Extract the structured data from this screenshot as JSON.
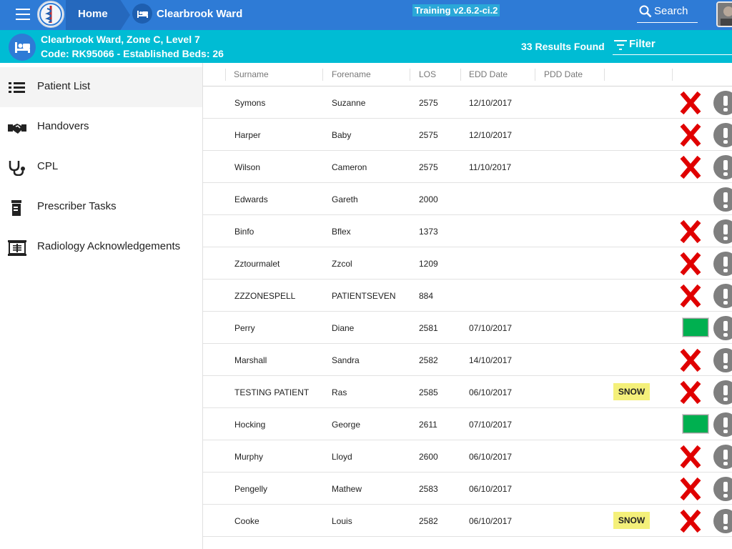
{
  "header": {
    "home_label": "Home",
    "ward_label": "Clearbrook Ward",
    "version": "Training v2.6.2-ci.2",
    "search_label": "Search"
  },
  "ward": {
    "line1": "Clearbrook Ward, Zone C, Level 7",
    "line2": "Code: RK95066 - Established Beds: 26",
    "results": "33 Results Found",
    "filter_label": "Filter"
  },
  "sidebar": {
    "items": [
      {
        "label": "Patient List",
        "icon": "list-icon"
      },
      {
        "label": "Handovers",
        "icon": "handshake-icon"
      },
      {
        "label": "CPL",
        "icon": "stethoscope-icon"
      },
      {
        "label": "Prescriber Tasks",
        "icon": "pill-bottle-icon"
      },
      {
        "label": "Radiology Acknowledgements",
        "icon": "xray-icon"
      }
    ]
  },
  "table": {
    "columns": [
      "Surname",
      "Forename",
      "LOS",
      "EDD Date",
      "PDD Date"
    ],
    "rows": [
      {
        "surname": "Symons",
        "forename": "Suzanne",
        "los": "2575",
        "edd": "12/10/2017",
        "pdd": "",
        "tag": "",
        "status": "red-x"
      },
      {
        "surname": "Harper",
        "forename": "Baby",
        "los": "2575",
        "edd": "12/10/2017",
        "pdd": "",
        "tag": "",
        "status": "red-x"
      },
      {
        "surname": "Wilson",
        "forename": "Cameron",
        "los": "2575",
        "edd": "11/10/2017",
        "pdd": "",
        "tag": "",
        "status": "red-x"
      },
      {
        "surname": "Edwards",
        "forename": "Gareth",
        "los": "2000",
        "edd": "",
        "pdd": "",
        "tag": "",
        "status": "none"
      },
      {
        "surname": "Binfo",
        "forename": "Bflex",
        "los": "1373",
        "edd": "",
        "pdd": "",
        "tag": "",
        "status": "red-x"
      },
      {
        "surname": "Zztourmalet",
        "forename": "Zzcol",
        "los": "1209",
        "edd": "",
        "pdd": "",
        "tag": "",
        "status": "red-x"
      },
      {
        "surname": "ZZZONESPELL",
        "forename": "PATIENTSEVEN",
        "los": "884",
        "edd": "",
        "pdd": "",
        "tag": "",
        "status": "red-x"
      },
      {
        "surname": "Perry",
        "forename": "Diane",
        "los": "2581",
        "edd": "07/10/2017",
        "pdd": "",
        "tag": "",
        "status": "green"
      },
      {
        "surname": "Marshall",
        "forename": "Sandra",
        "los": "2582",
        "edd": "14/10/2017",
        "pdd": "",
        "tag": "",
        "status": "red-x"
      },
      {
        "surname": "TESTING PATIENT",
        "forename": "Ras",
        "los": "2585",
        "edd": "06/10/2017",
        "pdd": "",
        "tag": "SNOW",
        "status": "red-x"
      },
      {
        "surname": "Hocking",
        "forename": "George",
        "los": "2611",
        "edd": "07/10/2017",
        "pdd": "",
        "tag": "",
        "status": "green"
      },
      {
        "surname": "Murphy",
        "forename": "Lloyd",
        "los": "2600",
        "edd": "06/10/2017",
        "pdd": "",
        "tag": "",
        "status": "red-x"
      },
      {
        "surname": "Pengelly",
        "forename": "Mathew",
        "los": "2583",
        "edd": "06/10/2017",
        "pdd": "",
        "tag": "",
        "status": "red-x"
      },
      {
        "surname": "Cooke",
        "forename": "Louis",
        "los": "2582",
        "edd": "06/10/2017",
        "pdd": "",
        "tag": "SNOW",
        "status": "red-x"
      }
    ]
  },
  "colors": {
    "topbar": "#2e7bd6",
    "wardbar": "#00bcd4",
    "status_red": "#e00000",
    "status_green": "#00b050",
    "alert_grey": "#7f7f7f",
    "snow_tag": "#f4f07a"
  }
}
